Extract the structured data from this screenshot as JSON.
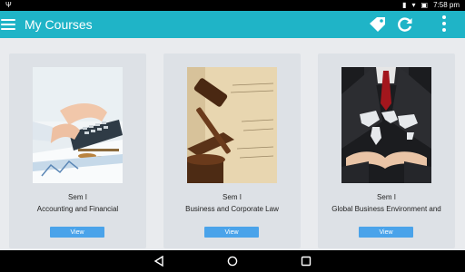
{
  "status_bar": {
    "usb_icon": "usb-icon",
    "time": "7:58 pm"
  },
  "app_bar": {
    "title": "My Courses",
    "menu_icon": "hamburger-icon",
    "tag_icon": "tag-icon",
    "refresh_icon": "refresh-icon",
    "more_icon": "more-vert-icon"
  },
  "courses": [
    {
      "semester": "Sem I",
      "name": "Accounting and Financial",
      "image": "accounting-image",
      "button_label": "View"
    },
    {
      "semester": "Sem I",
      "name": "Business and Corporate Law",
      "image": "gavel-image",
      "button_label": "View"
    },
    {
      "semester": "Sem I",
      "name": "Global Business Environment and",
      "image": "global-business-image",
      "button_label": "View"
    }
  ],
  "colors": {
    "primary": "#1fb4c7",
    "button": "#4aa3ea",
    "card": "#dde1e6",
    "background": "#e9ebee"
  }
}
